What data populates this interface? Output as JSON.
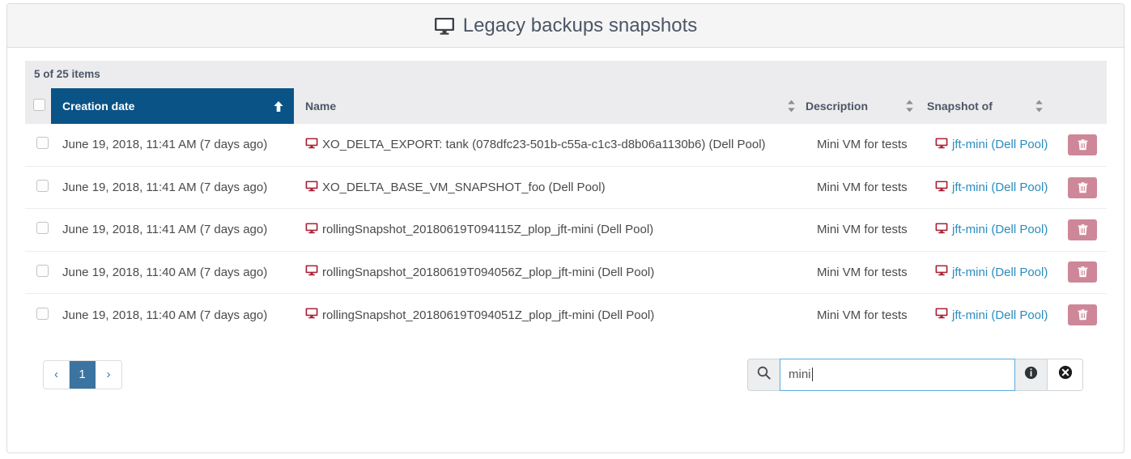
{
  "header": {
    "title": "Legacy backups snapshots",
    "icon": "monitor-icon"
  },
  "table": {
    "items_count_label": "5 of 25 items",
    "columns": [
      {
        "key": "check",
        "label": "",
        "icon": "checkbox"
      },
      {
        "key": "date",
        "label": "Creation date",
        "sorted": true,
        "sort_direction": "asc",
        "icon": "arrow-up-icon"
      },
      {
        "key": "name",
        "label": "Name",
        "sorted": false,
        "icon": "sort-icon"
      },
      {
        "key": "description",
        "label": "Description",
        "sorted": false,
        "icon": "sort-icon"
      },
      {
        "key": "snapshot_of",
        "label": "Snapshot of",
        "sorted": false,
        "icon": "sort-icon"
      },
      {
        "key": "actions",
        "label": "",
        "icon": ""
      }
    ],
    "rows": [
      {
        "date": "June 19, 2018, 11:41 AM (7 days ago)",
        "name": "XO_DELTA_EXPORT: tank (078dfc23-501b-c55a-c1c3-d8b06a1130b6) (Dell Pool)",
        "description": "Mini VM for tests",
        "snapshot_of": "jft-mini (Dell Pool)",
        "delete_icon": "trash-icon"
      },
      {
        "date": "June 19, 2018, 11:41 AM (7 days ago)",
        "name": "XO_DELTA_BASE_VM_SNAPSHOT_foo (Dell Pool)",
        "description": "Mini VM for tests",
        "snapshot_of": "jft-mini (Dell Pool)",
        "delete_icon": "trash-icon"
      },
      {
        "date": "June 19, 2018, 11:41 AM (7 days ago)",
        "name": "rollingSnapshot_20180619T094115Z_plop_jft-mini (Dell Pool)",
        "description": "Mini VM for tests",
        "snapshot_of": "jft-mini (Dell Pool)",
        "delete_icon": "trash-icon"
      },
      {
        "date": "June 19, 2018, 11:40 AM (7 days ago)",
        "name": "rollingSnapshot_20180619T094056Z_plop_jft-mini (Dell Pool)",
        "description": "Mini VM for tests",
        "snapshot_of": "jft-mini (Dell Pool)",
        "delete_icon": "trash-icon"
      },
      {
        "date": "June 19, 2018, 11:40 AM (7 days ago)",
        "name": "rollingSnapshot_20180619T094051Z_plop_jft-mini (Dell Pool)",
        "description": "Mini VM for tests",
        "snapshot_of": "jft-mini (Dell Pool)",
        "delete_icon": "trash-icon"
      }
    ]
  },
  "pagination": {
    "prev_label": "‹",
    "next_label": "›",
    "pages": [
      "1"
    ],
    "active_page": "1"
  },
  "search": {
    "icon": "search-icon",
    "value": "mini",
    "placeholder": "",
    "info_icon": "info-icon",
    "clear_icon": "clear-icon"
  },
  "colors": {
    "sorted_header_bg": "#0a5387",
    "header_bg": "#ececee",
    "link": "#2b8cbe",
    "vm_icon": "#a81c30",
    "delete_button_bg": "#ce8798",
    "pager_active_bg": "#3b74a0",
    "input_focus_border": "#5aaae0"
  }
}
